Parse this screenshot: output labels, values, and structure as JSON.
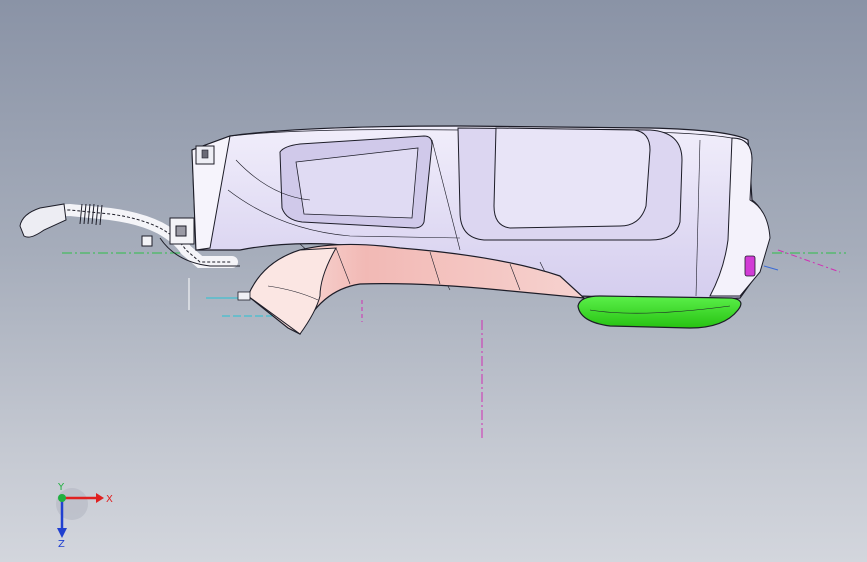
{
  "viewport": {
    "background_top": "#8a93a6",
    "background_bottom": "#d3d6dd"
  },
  "model": {
    "body_color": "#e4e0f4",
    "body_shade": "#c9c3e6",
    "lower_shell_color": "#f3c5c2",
    "lower_shell_highlight": "#fbe5e2",
    "foot_color": "#33e01f",
    "accent_color": "#d23cd6",
    "edge_color": "#1d1d28"
  },
  "reference_lines": {
    "magenta": "#d02fb4",
    "green": "#2fbf4a",
    "cyan": "#26c3d3",
    "white": "#ffffff"
  },
  "triad": {
    "x_label": "X",
    "y_label": "Y",
    "z_label": "Z",
    "x_color": "#e02020",
    "y_color": "#20b040",
    "z_color": "#2040d0"
  }
}
